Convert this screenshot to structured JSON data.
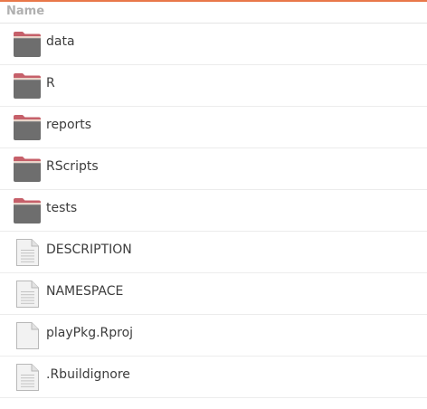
{
  "header": {
    "name_label": "Name"
  },
  "colors": {
    "accent": "#e9784a",
    "folder_tab": "#c6606a",
    "folder_body": "#6e6e6e",
    "document": "#f2f2f2"
  },
  "files": [
    {
      "name": "data",
      "icon": "folder-icon"
    },
    {
      "name": "R",
      "icon": "folder-icon"
    },
    {
      "name": "reports",
      "icon": "folder-icon"
    },
    {
      "name": "RScripts",
      "icon": "folder-icon"
    },
    {
      "name": "tests",
      "icon": "folder-icon"
    },
    {
      "name": "DESCRIPTION",
      "icon": "text-file-icon"
    },
    {
      "name": "NAMESPACE",
      "icon": "text-file-icon"
    },
    {
      "name": "playPkg.Rproj",
      "icon": "blank-file-icon"
    },
    {
      "name": ".Rbuildignore",
      "icon": "text-file-icon"
    }
  ]
}
